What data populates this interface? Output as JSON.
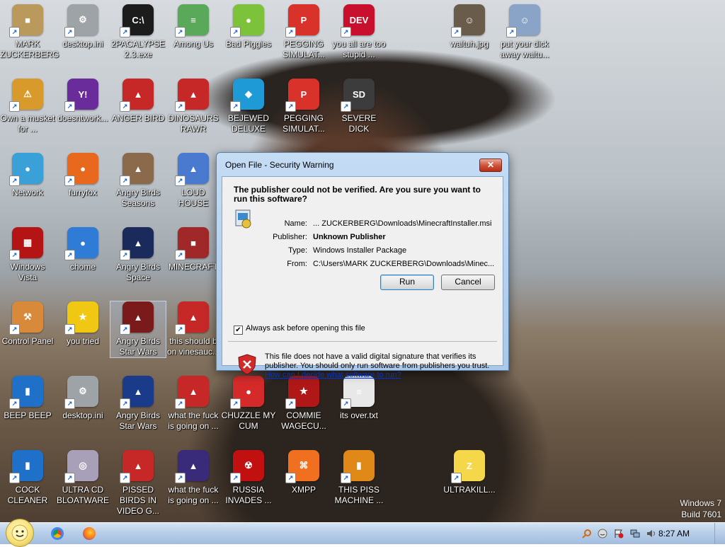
{
  "desktop": {
    "wallpaper_description": "",
    "icons": [
      {
        "label": "MARK ZUCKERBERG",
        "glyph": "■",
        "color": "#b99a5c"
      },
      {
        "label": "desktop.ini",
        "glyph": "⚙",
        "color": "#9ea3a8"
      },
      {
        "label": "2PACALYPSE 2.3.exe",
        "glyph": "C:\\",
        "color": "#1c1c1c"
      },
      {
        "label": "Among Us",
        "glyph": "≡",
        "color": "#5aa85a"
      },
      {
        "label": "Bad Piggies",
        "glyph": "●",
        "color": "#7cc23a"
      },
      {
        "label": "PEGGING SIMULAT...",
        "glyph": "P",
        "color": "#d8322a"
      },
      {
        "label": "you all are too stupid ...",
        "glyph": "DEV",
        "color": "#c8102e"
      },
      {
        "label": "waltuh.jpg",
        "glyph": "☺",
        "color": "#6a5c4a"
      },
      {
        "label": "put your dick away waltu...",
        "glyph": "☺",
        "color": "#8aa4c8"
      },
      {
        "label": "Own a musket for ...",
        "glyph": "⚠",
        "color": "#d89a2a"
      },
      {
        "label": "doesntwork...",
        "glyph": "Y!",
        "color": "#6a2c9a"
      },
      {
        "label": "ANGER BIRD",
        "glyph": "▲",
        "color": "#c62828"
      },
      {
        "label": "DINOSAURS RAWR",
        "glyph": "▲",
        "color": "#c62828"
      },
      {
        "label": "BEJEWED DELUXE",
        "glyph": "◆",
        "color": "#1e9ad6"
      },
      {
        "label": "PEGGING SIMULAT...",
        "glyph": "P",
        "color": "#d8322a"
      },
      {
        "label": "SEVERE DICK",
        "glyph": "SD",
        "color": "#3c3c3c"
      },
      {
        "label": "Network",
        "glyph": "●",
        "color": "#3aa0d8"
      },
      {
        "label": "furryfox",
        "glyph": "●",
        "color": "#e8681e"
      },
      {
        "label": "Angry Birds Seasons",
        "glyph": "▲",
        "color": "#8a6a4a"
      },
      {
        "label": "LOUD HOUSE",
        "glyph": "▲",
        "color": "#4a7ad0"
      },
      {
        "label": "Windows Vista",
        "glyph": "▦",
        "color": "#b41414"
      },
      {
        "label": "chome",
        "glyph": "●",
        "color": "#2e7cd6"
      },
      {
        "label": "Angry Birds Space",
        "glyph": "▲",
        "color": "#1a2a5a"
      },
      {
        "label": "MINECRAFT",
        "glyph": "■",
        "color": "#a02828"
      },
      {
        "label": "Control Panel",
        "glyph": "⚒",
        "color": "#d88a3a"
      },
      {
        "label": "you tried",
        "glyph": "★",
        "color": "#f0c814"
      },
      {
        "label": "Angry Birds Star Wars",
        "glyph": "▲",
        "color": "#7a1a1a"
      },
      {
        "label": "this should b on vinesauc...",
        "glyph": "▲",
        "color": "#c62828"
      },
      {
        "label": "BEEP BEEP",
        "glyph": "▮",
        "color": "#1f70c8"
      },
      {
        "label": "desktop.ini",
        "glyph": "⚙",
        "color": "#9ea3a8"
      },
      {
        "label": "Angry Birds Star Wars",
        "glyph": "▲",
        "color": "#1a3a8a"
      },
      {
        "label": "what the fuck is going on ...",
        "glyph": "▲",
        "color": "#c62828"
      },
      {
        "label": "CHUZZLE MY CUM",
        "glyph": "●",
        "color": "#d42a2a"
      },
      {
        "label": "COMMIE WAGECU...",
        "glyph": "★",
        "color": "#b01818"
      },
      {
        "label": "its over.txt",
        "glyph": "≡",
        "color": "#e8e8e8"
      },
      {
        "label": "COCK CLEANER",
        "glyph": "▮",
        "color": "#1f70c8"
      },
      {
        "label": "ULTRA CD BLOATWARE",
        "glyph": "◎",
        "color": "#a8a0b8"
      },
      {
        "label": "PISSED BIRDS IN VIDEO G...",
        "glyph": "▲",
        "color": "#c62828"
      },
      {
        "label": "what the fuck is going on ...",
        "glyph": "▲",
        "color": "#3a2a7a"
      },
      {
        "label": "RUSSIA INVADES ...",
        "glyph": "☢",
        "color": "#c01010"
      },
      {
        "label": "XMPP",
        "glyph": "⌘",
        "color": "#f07020"
      },
      {
        "label": "THIS PISS MACHINE ...",
        "glyph": "▮",
        "color": "#e08818"
      },
      {
        "label": "ULTRAKILL...",
        "glyph": "Z",
        "color": "#f5d84a"
      }
    ],
    "watermark_line1": "Windows 7",
    "watermark_line2": "Build 7601"
  },
  "dialog": {
    "title": "Open File - Security Warning",
    "close_glyph": "✕",
    "heading": "The publisher could not be verified.  Are you sure you want to run this software?",
    "fields": [
      {
        "key": "Name:",
        "value": "... ZUCKERBERG\\Downloads\\MinecraftInstaller.msi",
        "bold": false
      },
      {
        "key": "Publisher:",
        "value": "Unknown Publisher",
        "bold": true
      },
      {
        "key": "Type:",
        "value": "Windows Installer Package",
        "bold": false
      },
      {
        "key": "From:",
        "value": "C:\\Users\\MARK ZUCKERBERG\\Downloads\\Minec...",
        "bold": false
      }
    ],
    "run_label": "Run",
    "cancel_label": "Cancel",
    "checkbox_label": "Always ask before opening this file",
    "checkbox_checked": true,
    "warning_text": "This file does not have a valid digital signature that verifies its publisher.  You should only run software from publishers you trust.",
    "help_link": "How can I decide what software to run?"
  },
  "taskbar": {
    "clock": "8:27 AM",
    "start_label": "Start"
  }
}
